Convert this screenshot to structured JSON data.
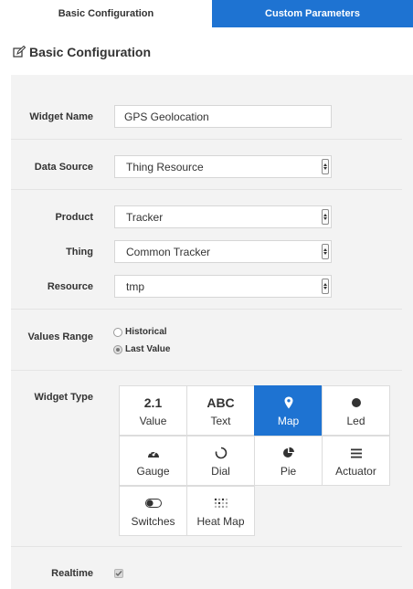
{
  "tabs": {
    "basic": "Basic Configuration",
    "custom": "Custom Parameters"
  },
  "section_title": "Basic Configuration",
  "fields": {
    "widget_name": {
      "label": "Widget Name",
      "value": "GPS Geolocation"
    },
    "data_source": {
      "label": "Data Source",
      "value": "Thing Resource"
    },
    "product": {
      "label": "Product",
      "value": "Tracker"
    },
    "thing": {
      "label": "Thing",
      "value": "Common Tracker"
    },
    "resource": {
      "label": "Resource",
      "value": "tmp"
    }
  },
  "values_range": {
    "label": "Values Range",
    "options": [
      "Historical",
      "Last Value"
    ],
    "selected": "Last Value"
  },
  "widget_type": {
    "label": "Widget Type",
    "selected": "Map",
    "tiles": [
      {
        "icon_text": "2.1",
        "label": "Value",
        "icon": "number-icon"
      },
      {
        "icon_text": "ABC",
        "label": "Text",
        "icon": "text-icon"
      },
      {
        "icon_text": "",
        "label": "Map",
        "icon": "map-marker-icon"
      },
      {
        "icon_text": "",
        "label": "Led",
        "icon": "led-dot-icon"
      },
      {
        "icon_text": "",
        "label": "Gauge",
        "icon": "gauge-icon"
      },
      {
        "icon_text": "",
        "label": "Dial",
        "icon": "dial-icon"
      },
      {
        "icon_text": "",
        "label": "Pie",
        "icon": "pie-icon"
      },
      {
        "icon_text": "",
        "label": "Actuator",
        "icon": "actuator-icon"
      },
      {
        "icon_text": "",
        "label": "Switches",
        "icon": "toggle-icon"
      },
      {
        "icon_text": "",
        "label": "Heat Map",
        "icon": "heatmap-icon"
      }
    ]
  },
  "realtime": {
    "label": "Realtime",
    "checked": true
  },
  "colors": {
    "accent": "#1e73d2",
    "panel_bg": "#f3f3f3"
  }
}
